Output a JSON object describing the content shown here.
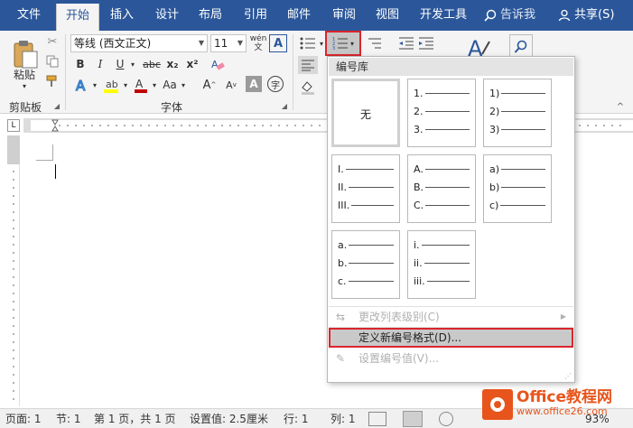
{
  "tabs": [
    "文件",
    "开始",
    "插入",
    "设计",
    "布局",
    "引用",
    "邮件",
    "审阅",
    "视图",
    "开发工具"
  ],
  "active_tab": "开始",
  "tell_me": "告诉我",
  "share": "共享(S)",
  "ribbon": {
    "paste_label": "粘贴",
    "clipboard_label": "剪贴板",
    "font_label": "字体",
    "font_name": "等线 (西文正文)",
    "font_size": "11",
    "wen_label": "wén 文",
    "bold": "B",
    "italic": "I",
    "underline": "U",
    "strike": "abc",
    "subscript": "x₂",
    "superscript": "x²",
    "grow_font": "A",
    "shrink_font": "A",
    "char_shade": "A",
    "phonetic": "字"
  },
  "dropdown": {
    "header": "编号库",
    "none_label": "无",
    "tiles": [
      [
        "1.",
        "2.",
        "3."
      ],
      [
        "1)",
        "2)",
        "3)"
      ],
      [
        "I.",
        "II.",
        "III."
      ],
      [
        "A.",
        "B.",
        "C."
      ],
      [
        "a)",
        "b)",
        "c)"
      ],
      [
        "a.",
        "b.",
        "c."
      ],
      [
        "i.",
        "ii.",
        "iii."
      ]
    ],
    "items": {
      "change_level": "更改列表级别(C)",
      "define_new": "定义新编号格式(D)...",
      "set_value": "设置编号值(V)..."
    }
  },
  "status": {
    "page": "页面: 1",
    "section": "节: 1",
    "page_of": "第 1 页，共 1 页",
    "setting": "设置值: 2.5厘米",
    "line": "行: 1",
    "column": "列: 1",
    "zoom": "93%"
  },
  "watermark": {
    "line1": "Office教程网",
    "line2": "www.office26.com"
  },
  "colors": {
    "ribbon_blue": "#2b579a",
    "highlight_red": "#d9262c",
    "font_color_red": "#c00000",
    "highlight_yellow": "#ffff00"
  }
}
